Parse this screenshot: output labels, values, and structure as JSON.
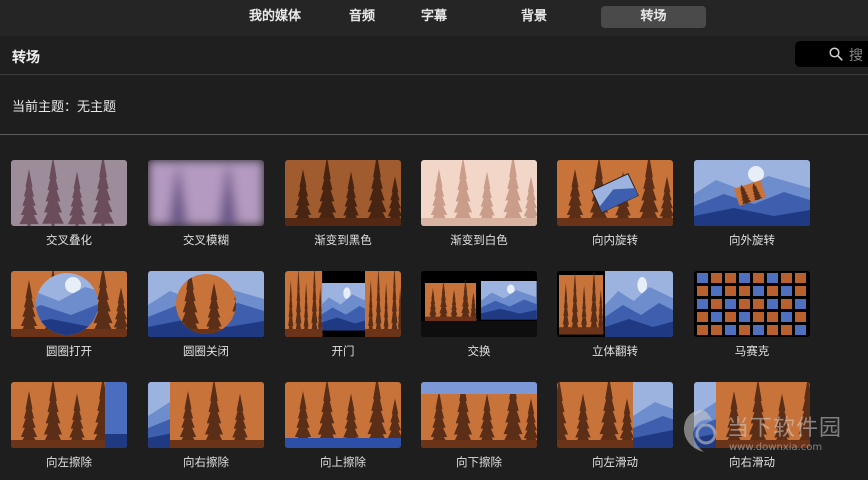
{
  "tabs": [
    "我的媒体",
    "音频",
    "字幕",
    "背景",
    "转场"
  ],
  "active_tab": "转场",
  "header": {
    "title": "转场",
    "search_text": "搜"
  },
  "theme_line": "当前主题：无主题",
  "transitions": [
    [
      "交叉叠化",
      "交叉模糊",
      "渐变到黑色",
      "渐变到白色",
      "向内旋转",
      "向外旋转"
    ],
    [
      "圆圈打开",
      "圆圈关闭",
      "开门",
      "交换",
      "立体翻转",
      "马赛克"
    ],
    [
      "向左擦除",
      "向右擦除",
      "向上擦除",
      "向下擦除",
      "向左滑动",
      "向右滑动"
    ]
  ],
  "watermark": {
    "name": "当下软件园",
    "url": "www.downxia.com"
  }
}
